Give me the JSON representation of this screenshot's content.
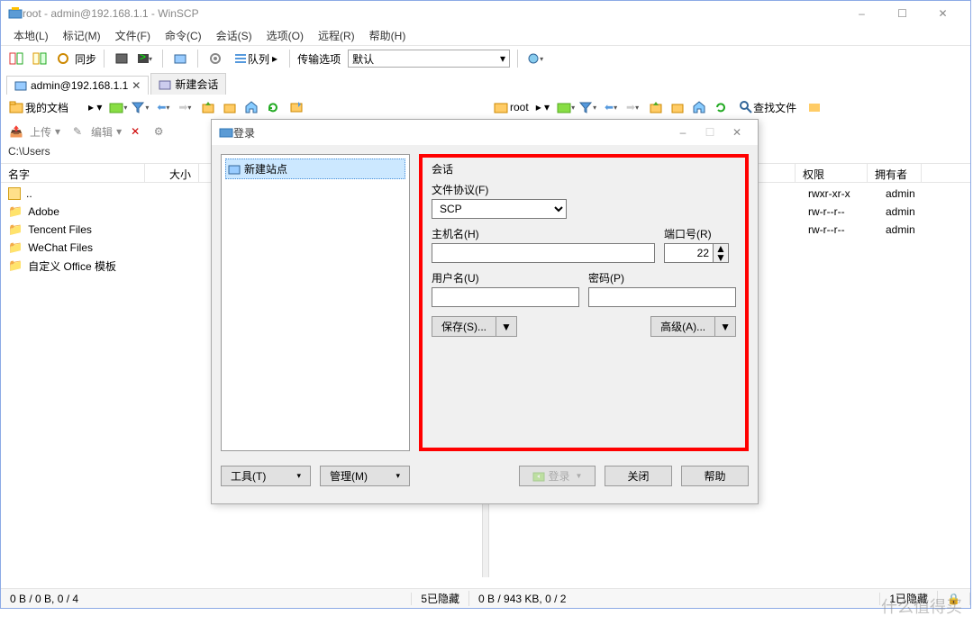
{
  "window": {
    "title": "root - admin@192.168.1.1 - WinSCP",
    "min_icon": "–",
    "max_icon": "☐",
    "close_icon": "✕"
  },
  "menu": {
    "items": [
      "本地(L)",
      "标记(M)",
      "文件(F)",
      "命令(C)",
      "会话(S)",
      "选项(O)",
      "远程(R)",
      "帮助(H)"
    ]
  },
  "toolbar": {
    "sync_label": "同步",
    "queue_label": "队列",
    "transfer_label": "传输选项",
    "transfer_value": "默认"
  },
  "tabs": {
    "active": "admin@192.168.1.1",
    "new": "新建会话"
  },
  "left_panel": {
    "combo": "我的文档",
    "upload": "上传",
    "edit": "编辑",
    "path": "C:\\Users",
    "columns": {
      "name": "名字",
      "size": "大小"
    },
    "items": [
      {
        "name": "..",
        "type": "up"
      },
      {
        "name": "Adobe",
        "type": "folder"
      },
      {
        "name": "Tencent Files",
        "type": "folder"
      },
      {
        "name": "WeChat Files",
        "type": "folder"
      },
      {
        "name": "自定义 Office 模板",
        "type": "folder"
      }
    ]
  },
  "right_panel": {
    "combo": "root",
    "find_label": "查找文件",
    "columns": {
      "perm": "权限",
      "owner": "拥有者"
    },
    "items": [
      {
        "perm": "rwxr-xr-x",
        "owner": "admin"
      },
      {
        "perm": "rw-r--r--",
        "owner": "admin"
      },
      {
        "perm": "rw-r--r--",
        "owner": "admin"
      }
    ]
  },
  "login_dialog": {
    "title": "登录",
    "new_site": "新建站点",
    "session_label": "会话",
    "protocol_label": "文件协议(F)",
    "protocol_value": "SCP",
    "host_label": "主机名(H)",
    "host_value": "",
    "port_label": "端口号(R)",
    "port_value": "22",
    "user_label": "用户名(U)",
    "user_value": "",
    "pass_label": "密码(P)",
    "pass_value": "",
    "save_btn": "保存(S)...",
    "advanced_btn": "高级(A)...",
    "tools_btn": "工具(T)",
    "manage_btn": "管理(M)",
    "login_btn": "登录",
    "close_btn": "关闭",
    "help_btn": "帮助"
  },
  "status": {
    "left": "0 B / 0 B, 0 / 4",
    "right_hidden": "5已隐藏",
    "right": "0 B / 943 KB, 0 / 2",
    "far_right": "1已隐藏"
  },
  "watermark": "什么值得买"
}
